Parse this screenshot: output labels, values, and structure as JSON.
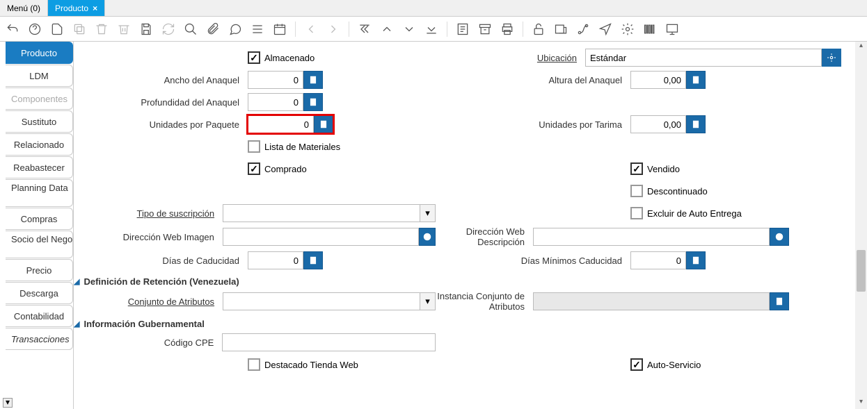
{
  "tabs": {
    "menu": "Menú (0)",
    "active": "Producto"
  },
  "sideTabs": [
    "Producto",
    "LDM",
    "Componentes",
    "Sustituto",
    "Relacionado",
    "Reabastecer",
    "Planning Data",
    "Compras",
    "Socio del Negocio",
    "Precio",
    "Descarga",
    "Contabilidad",
    "Transacciones"
  ],
  "fields": {
    "almacenado": "Almacenado",
    "ubicacion_lbl": "Ubicación",
    "ubicacion_val": "Estándar",
    "ancho_lbl": "Ancho del Anaquel",
    "ancho_val": "0",
    "altura_lbl": "Altura del Anaquel",
    "altura_val": "0,00",
    "prof_lbl": "Profundidad del Anaquel",
    "prof_val": "0",
    "upaq_lbl": "Unidades por Paquete",
    "upaq_val": "0",
    "utar_lbl": "Unidades por Tarima",
    "utar_val": "0,00",
    "lmat": "Lista de Materiales",
    "comprado": "Comprado",
    "vendido": "Vendido",
    "descont": "Descontinuado",
    "tsus_lbl": "Tipo de suscripción",
    "excl": "Excluir de Auto Entrega",
    "dwi_lbl": "Dirección Web Imagen",
    "dwd_lbl": "Dirección Web Descripción",
    "dcad_lbl": "Días de Caducidad",
    "dcad_val": "0",
    "dmcad_lbl": "Días Mínimos Caducidad",
    "dmcad_val": "0",
    "sec1": "Definición de Retención (Venezuela)",
    "catr_lbl": "Conjunto de Atributos",
    "ica_lbl": "Instancia Conjunto de Atributos",
    "sec2": "Información Gubernamental",
    "ccpe_lbl": "Código CPE",
    "dtw": "Destacado Tienda Web",
    "autos": "Auto-Servicio"
  }
}
